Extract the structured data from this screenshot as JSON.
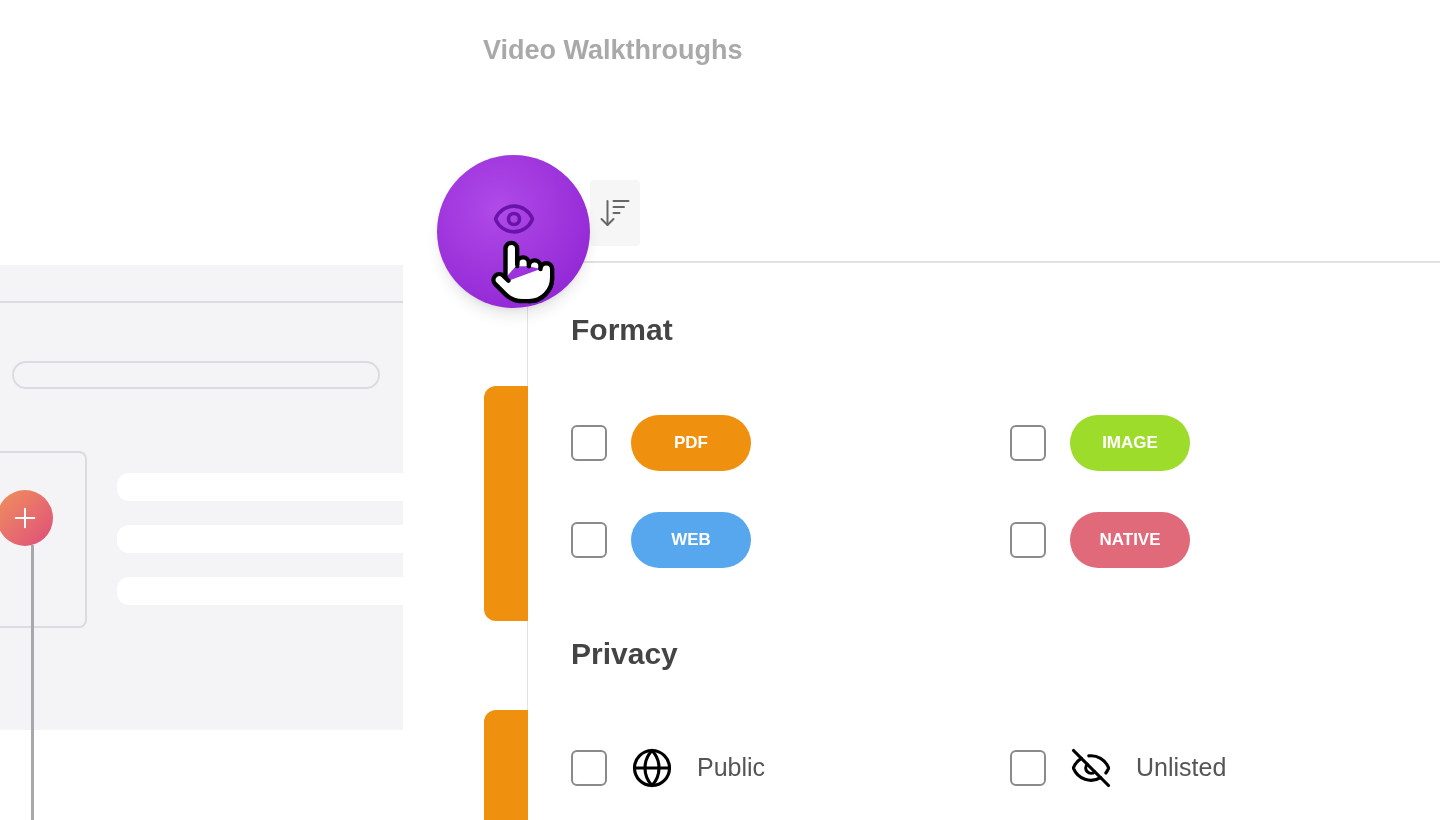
{
  "title": "Video Walkthroughs",
  "sections": [
    {
      "title": "Format",
      "options": [
        {
          "kind": "tag",
          "label": "PDF",
          "color": "#f0900f",
          "checked": false
        },
        {
          "kind": "tag",
          "label": "IMAGE",
          "color": "#9ddc2a",
          "checked": false
        },
        {
          "kind": "tag",
          "label": "WEB",
          "color": "#57a7ef",
          "checked": false
        },
        {
          "kind": "tag",
          "label": "NATIVE",
          "color": "#e0697a",
          "checked": false
        }
      ]
    },
    {
      "title": "Privacy",
      "options": [
        {
          "kind": "icon",
          "label": "Public",
          "checked": false
        },
        {
          "kind": "icon",
          "label": "Unlisted",
          "checked": false
        }
      ]
    }
  ]
}
